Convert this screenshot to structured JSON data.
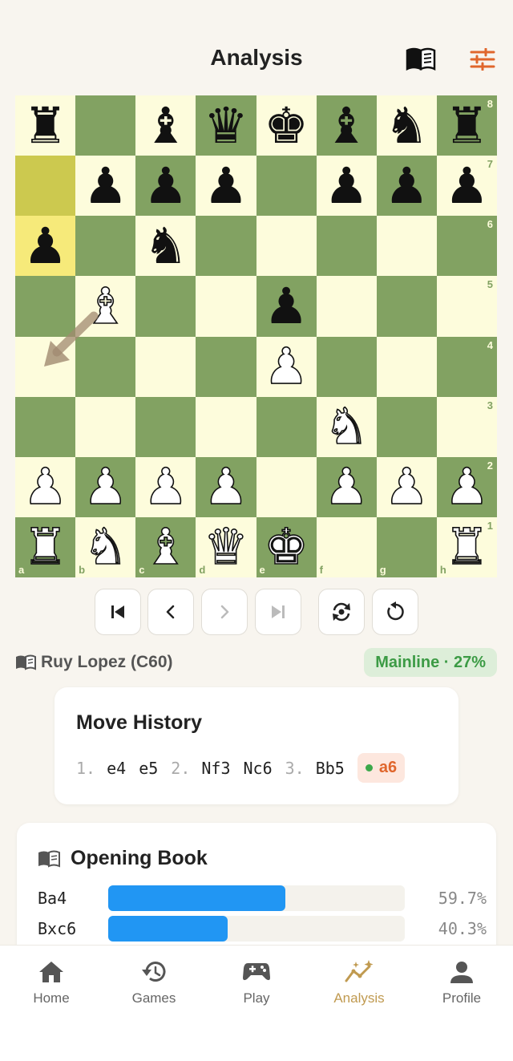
{
  "header": {
    "title": "Analysis",
    "book_icon": "book-icon",
    "settings_icon": "sliders-icon",
    "accent": "#e0662c"
  },
  "board": {
    "light_color": "#fdfcdc",
    "dark_color": "#82a262",
    "highlight_from": "a7",
    "highlight_to": "a6",
    "arrow": {
      "from": "b5",
      "to": "a4",
      "color": "#a08a70"
    },
    "ranks": [
      "8",
      "7",
      "6",
      "5",
      "4",
      "3",
      "2",
      "1"
    ],
    "files": [
      "a",
      "b",
      "c",
      "d",
      "e",
      "f",
      "g",
      "h"
    ],
    "position": [
      [
        "r",
        "",
        "b",
        "q",
        "k",
        "b",
        "n",
        "r"
      ],
      [
        "",
        "p",
        "p",
        "p",
        "",
        "p",
        "p",
        "p"
      ],
      [
        "p",
        "",
        "n",
        "",
        "",
        "",
        "",
        ""
      ],
      [
        "",
        "B",
        "",
        "",
        "p",
        "",
        "",
        ""
      ],
      [
        "",
        "",
        "",
        "",
        "P",
        "",
        "",
        ""
      ],
      [
        "",
        "",
        "",
        "",
        "",
        "N",
        "",
        ""
      ],
      [
        "P",
        "P",
        "P",
        "P",
        "",
        "P",
        "P",
        "P"
      ],
      [
        "R",
        "N",
        "B",
        "Q",
        "K",
        "",
        "",
        "R"
      ]
    ]
  },
  "controls": [
    {
      "name": "first-move-button",
      "icon": "skip-start-icon",
      "disabled": false
    },
    {
      "name": "prev-move-button",
      "icon": "chevron-left-icon",
      "disabled": false
    },
    {
      "name": "next-move-button",
      "icon": "chevron-right-icon",
      "disabled": true
    },
    {
      "name": "last-move-button",
      "icon": "skip-end-icon",
      "disabled": true
    },
    {
      "name": "flip-board-button",
      "icon": "flip-icon",
      "disabled": false
    },
    {
      "name": "reset-button",
      "icon": "rotate-icon",
      "disabled": false
    }
  ],
  "opening": {
    "name": "Ruy Lopez (C60)",
    "badge": "Mainline · 27%"
  },
  "history": {
    "title": "Move History",
    "moves": [
      {
        "num": "1.",
        "white": "e4",
        "black": "e5"
      },
      {
        "num": "2.",
        "white": "Nf3",
        "black": "Nc6"
      },
      {
        "num": "3.",
        "white": "Bb5",
        "black": "a6"
      }
    ],
    "current": "a6"
  },
  "book": {
    "title": "Opening Book",
    "rows": [
      {
        "move": "Ba4",
        "pct_label": "59.7%",
        "fraction": 0.597
      },
      {
        "move": "Bxc6",
        "pct_label": "40.3%",
        "fraction": 0.403
      }
    ],
    "bar_color": "#2196f3"
  },
  "nav": {
    "active": "Analysis",
    "items": [
      {
        "label": "Home",
        "icon": "home-icon"
      },
      {
        "label": "Games",
        "icon": "history-icon"
      },
      {
        "label": "Play",
        "icon": "gamepad-icon"
      },
      {
        "label": "Analysis",
        "icon": "analysis-icon"
      },
      {
        "label": "Profile",
        "icon": "person-icon"
      }
    ]
  }
}
